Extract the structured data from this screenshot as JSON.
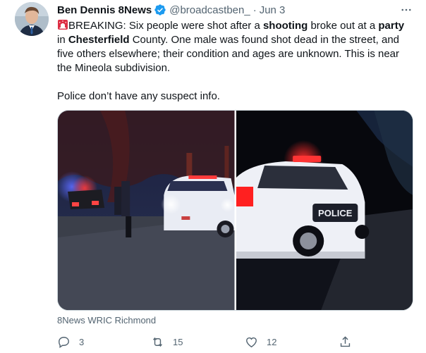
{
  "tweet": {
    "author_name": "Ben Dennis 8News",
    "handle": "@broadcastben_",
    "separator": "·",
    "date": "Jun 3",
    "text": {
      "breaking": "BREAKING: Six people were shot after a ",
      "kw_shooting": "shooting",
      "mid1": " broke out at a ",
      "kw_party": "party",
      "mid2": "in ",
      "kw_chesterfield": "Chesterfield",
      "rest": " County. One male was found shot dead in the street, and five others elsewhere; their condition and ages are unknown. This is near the Mineola subdivision.",
      "second_para": "Police don’t have any suspect info."
    },
    "media_source": "8News WRIC Richmond",
    "photo2_vehicle_text": "POLICE",
    "replies": "3",
    "retweets": "15",
    "likes": "12",
    "icons": [
      "verified-badge-icon",
      "more-icon",
      "siren-emoji-icon",
      "reply-icon",
      "retweet-icon",
      "like-icon",
      "share-icon"
    ],
    "colors": {
      "verified": "#1d9bf0",
      "muted": "#536471",
      "text": "#0f1419"
    }
  }
}
